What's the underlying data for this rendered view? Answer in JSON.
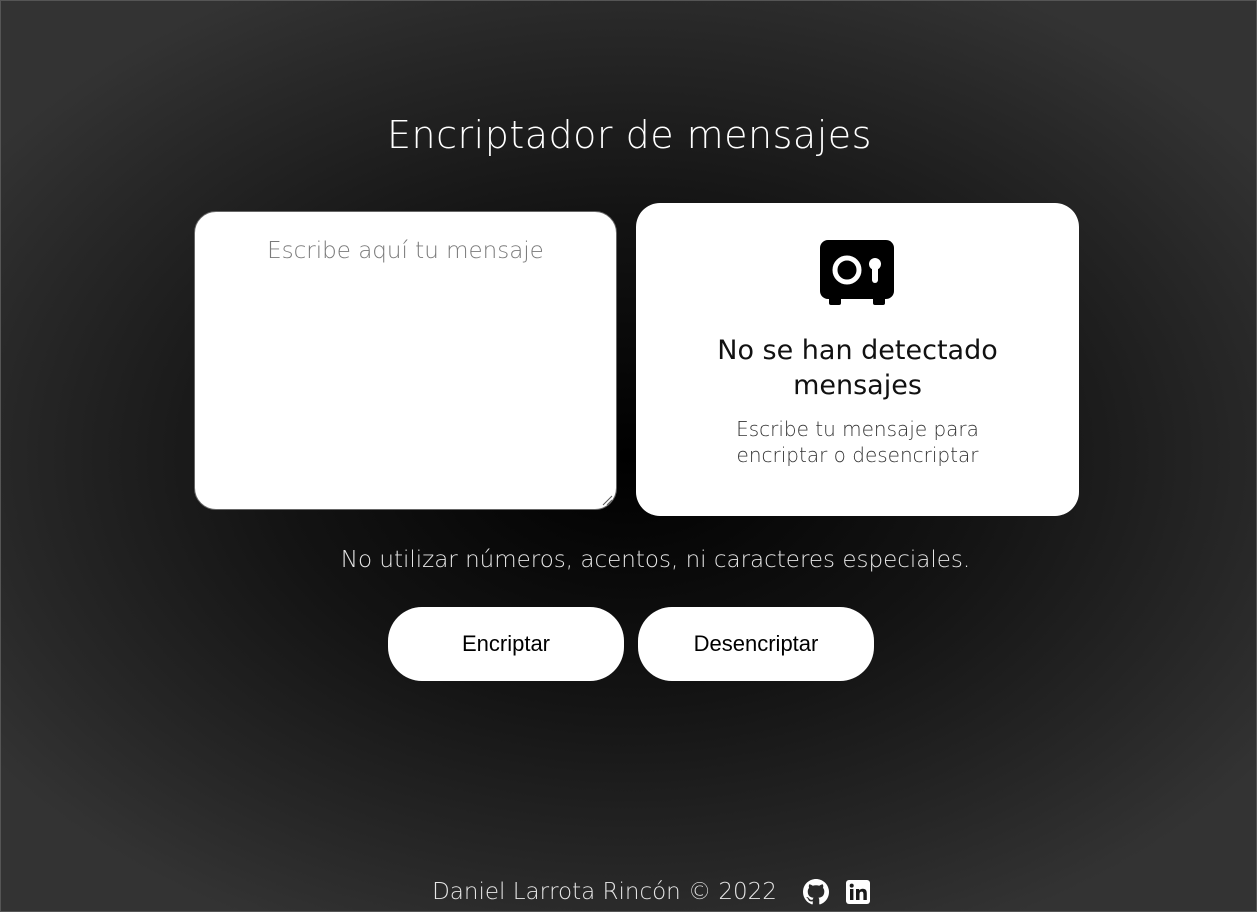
{
  "page": {
    "title": "Encriptador de mensajes"
  },
  "input": {
    "placeholder": "Escribe aquí tu mensaje",
    "value": ""
  },
  "output": {
    "icon": "safe-icon",
    "heading": "No se han detectado mensajes",
    "subtext": "Escribe tu mensaje para encriptar o desencriptar"
  },
  "warning": "No utilizar números, acentos, ni caracteres especiales.",
  "buttons": {
    "encrypt_label": "Encriptar",
    "decrypt_label": "Desencriptar"
  },
  "footer": {
    "text": "Daniel Larrota Rincón © 2022",
    "links": [
      {
        "icon": "github-icon"
      },
      {
        "icon": "linkedin-icon"
      }
    ]
  },
  "colors": {
    "background_center": "#000000",
    "background_edge": "#333333",
    "card": "#ffffff",
    "text_light": "#e6e6e6"
  }
}
